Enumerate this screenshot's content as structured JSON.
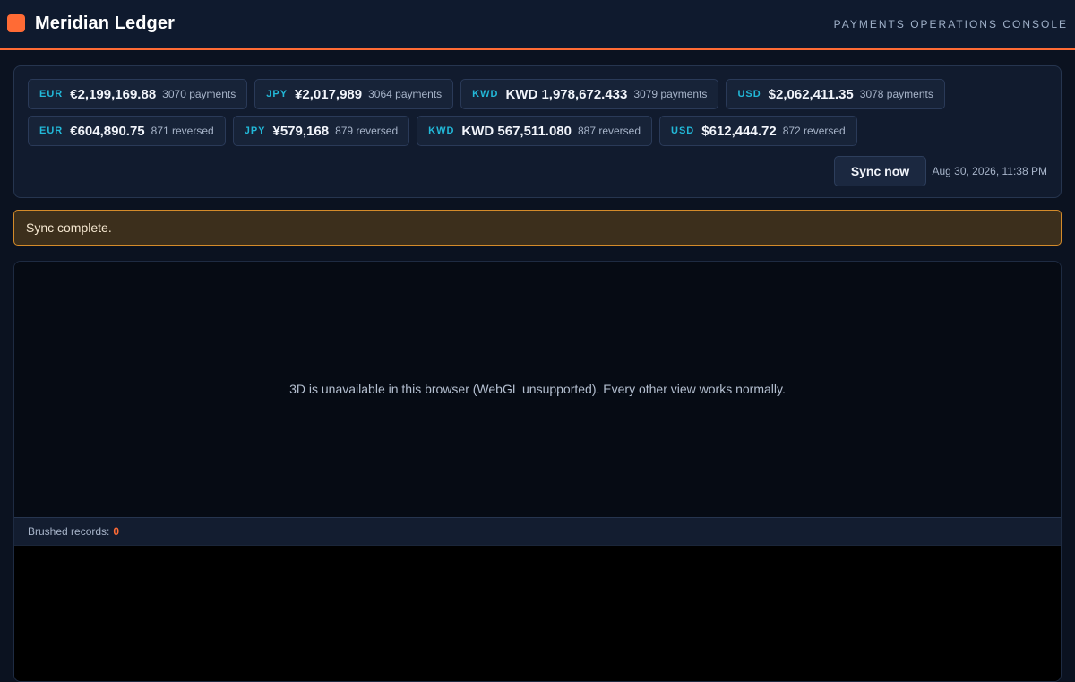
{
  "app": {
    "title": "Meridian Ledger",
    "console_label": "PAYMENTS OPERATIONS CONSOLE"
  },
  "totals": {
    "payments": [
      {
        "currency": "EUR",
        "amount": "€2,199,169.88",
        "count": "3070 payments"
      },
      {
        "currency": "JPY",
        "amount": "¥2,017,989",
        "count": "3064 payments"
      },
      {
        "currency": "KWD",
        "amount": "KWD 1,978,672.433",
        "count": "3079 payments"
      },
      {
        "currency": "USD",
        "amount": "$2,062,411.35",
        "count": "3078 payments"
      }
    ],
    "reversed": [
      {
        "currency": "EUR",
        "amount": "€604,890.75",
        "count": "871 reversed"
      },
      {
        "currency": "JPY",
        "amount": "¥579,168",
        "count": "879 reversed"
      },
      {
        "currency": "KWD",
        "amount": "KWD 567,511.080",
        "count": "887 reversed"
      },
      {
        "currency": "USD",
        "amount": "$612,444.72",
        "count": "872 reversed"
      }
    ]
  },
  "sync": {
    "button_label": "Sync now",
    "last_synced": "Aug 30, 2026, 11:38 PM",
    "status_message": "Sync complete."
  },
  "viewer": {
    "webgl_message": "3D is unavailable in this browser (WebGL unsupported). Every other view works normally.",
    "brushed_label": "Brushed records:",
    "brushed_count": "0"
  },
  "colors": {
    "accent": "#ff6b35",
    "currency_code": "#22b8d8",
    "banner_border": "#d48b2a",
    "banner_bg": "#3c2f1c"
  }
}
